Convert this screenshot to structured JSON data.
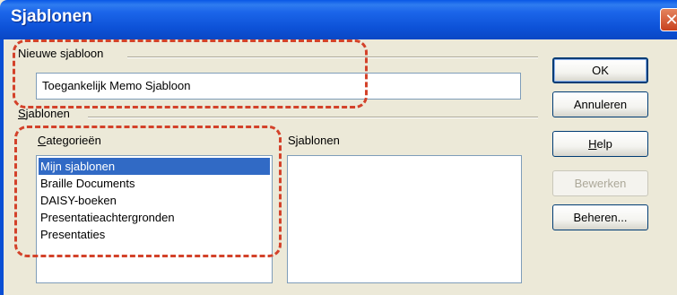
{
  "window": {
    "title": "Sjablonen",
    "close_glyph": "✕"
  },
  "new_template": {
    "group_label": "Nieuwe sjabloon",
    "name_value": "Toegankelijk Memo Sjabloon"
  },
  "templates_group": {
    "group_label": "Sjablonen",
    "categories_label": "Categorieën",
    "categories": [
      "Mijn sjablonen",
      "Braille Documents",
      "DAISY-boeken",
      "Presentatieachtergronden",
      "Presentaties"
    ],
    "selected_category_index": 0,
    "templates_label": "Sjablonen",
    "templates": []
  },
  "buttons": {
    "ok": "OK",
    "cancel": "Annuleren",
    "help": "Help",
    "edit": "Bewerken",
    "manage": "Beheren..."
  },
  "annotation_color": "#d3422a"
}
